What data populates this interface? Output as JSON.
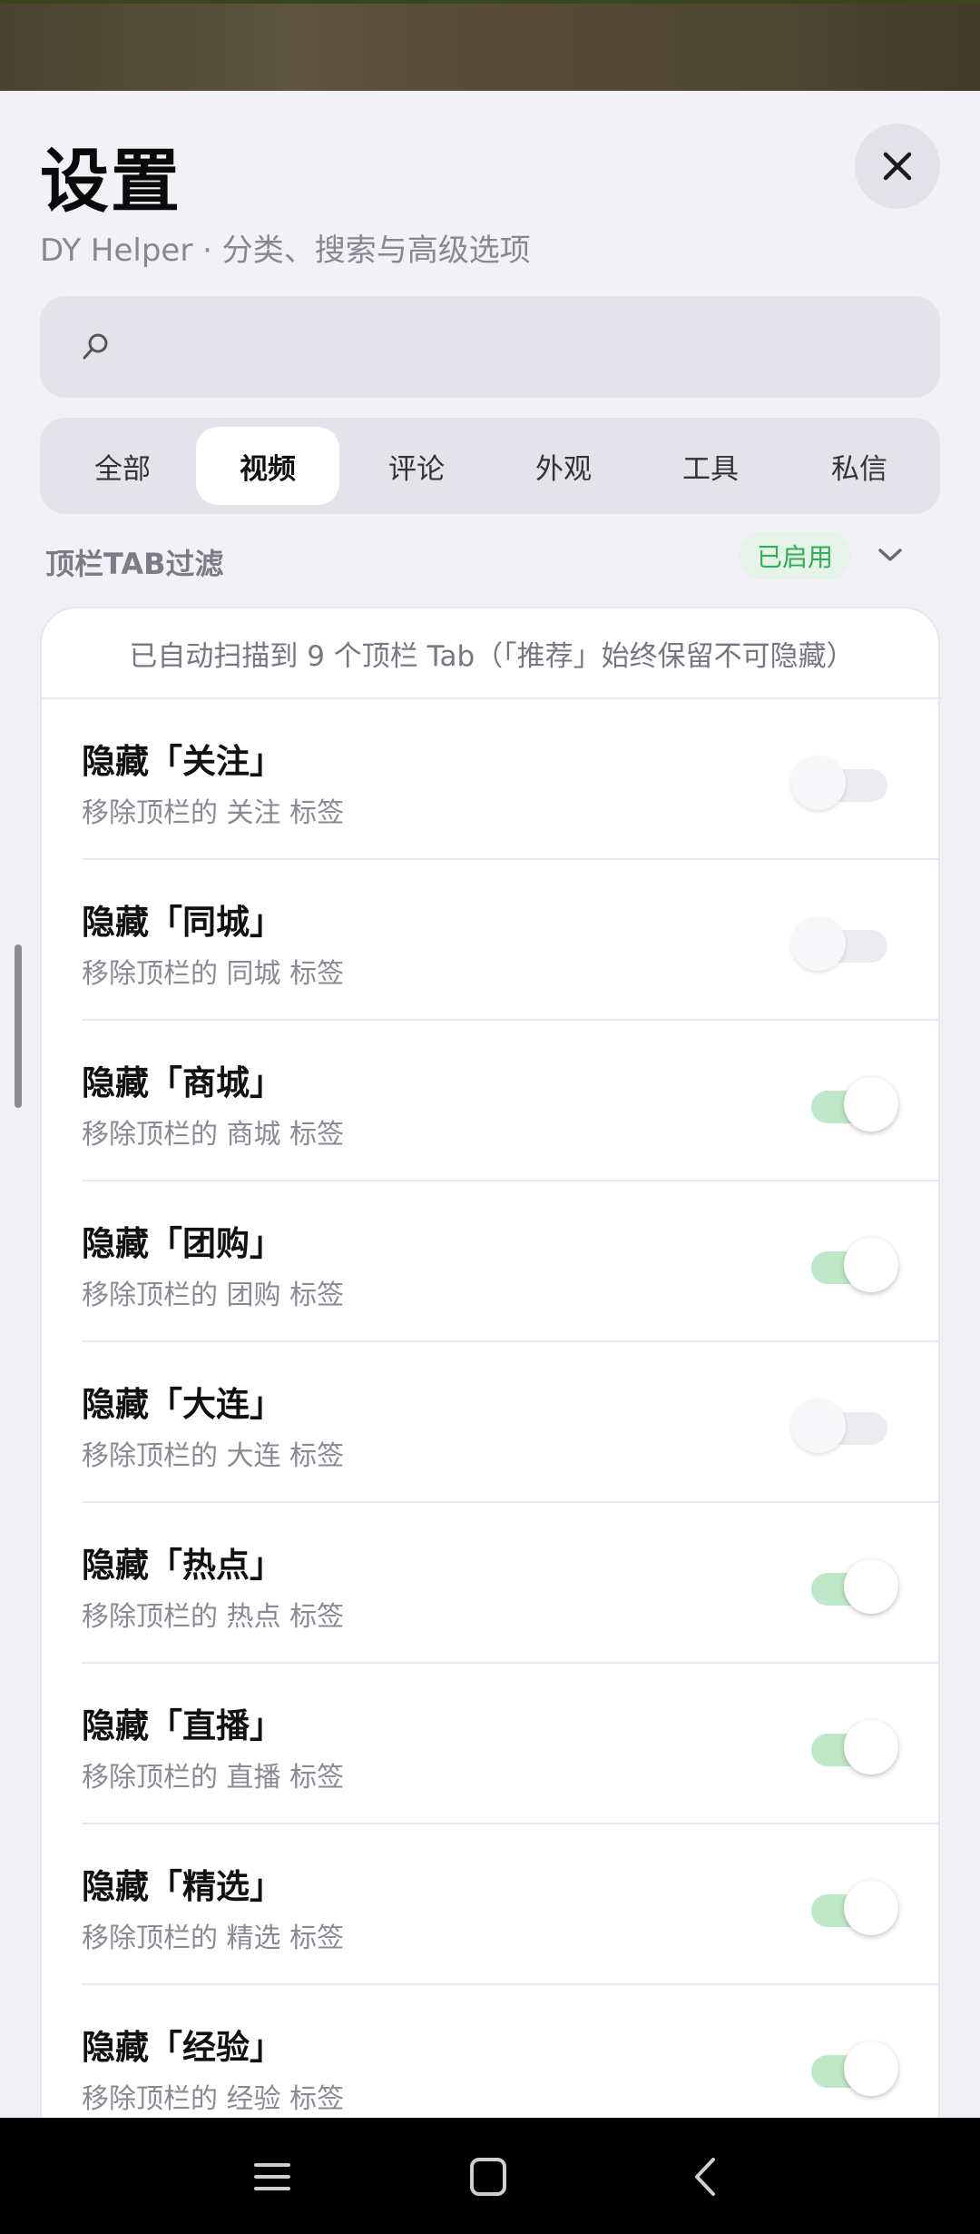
{
  "header": {
    "title": "设置",
    "subtitle": "DY Helper · 分类、搜索与高级选项",
    "close_icon": "close-icon"
  },
  "search": {
    "placeholder": "",
    "value": "",
    "icon": "search-icon"
  },
  "tabs": [
    {
      "label": "全部",
      "active": false
    },
    {
      "label": "视频",
      "active": true
    },
    {
      "label": "评论",
      "active": false
    },
    {
      "label": "外观",
      "active": false
    },
    {
      "label": "工具",
      "active": false
    },
    {
      "label": "私信",
      "active": false
    }
  ],
  "section": {
    "label": "顶栏TAB过滤",
    "status": "已启用",
    "expand_icon": "chevron-down-icon"
  },
  "card": {
    "note": "已自动扫描到 9 个顶栏 Tab（「推荐」始终保留不可隐藏）",
    "rows": [
      {
        "title": "隐藏「关注」",
        "desc": "移除顶栏的 关注 标签",
        "on": false
      },
      {
        "title": "隐藏「同城」",
        "desc": "移除顶栏的 同城 标签",
        "on": false
      },
      {
        "title": "隐藏「商城」",
        "desc": "移除顶栏的 商城 标签",
        "on": true
      },
      {
        "title": "隐藏「团购」",
        "desc": "移除顶栏的 团购 标签",
        "on": true
      },
      {
        "title": "隐藏「大连」",
        "desc": "移除顶栏的 大连 标签",
        "on": false
      },
      {
        "title": "隐藏「热点」",
        "desc": "移除顶栏的 热点 标签",
        "on": true
      },
      {
        "title": "隐藏「直播」",
        "desc": "移除顶栏的 直播 标签",
        "on": true
      },
      {
        "title": "隐藏「精选」",
        "desc": "移除顶栏的 精选 标签",
        "on": true
      },
      {
        "title": "隐藏「经验」",
        "desc": "移除顶栏的 经验 标签",
        "on": true
      }
    ]
  },
  "colors": {
    "accent_green": "#2fae55",
    "toggle_on_track": "#bfe8c8",
    "background": "#f1f1f6"
  },
  "navbar": {
    "icons": [
      "menu-icon",
      "home-icon",
      "back-icon"
    ]
  }
}
